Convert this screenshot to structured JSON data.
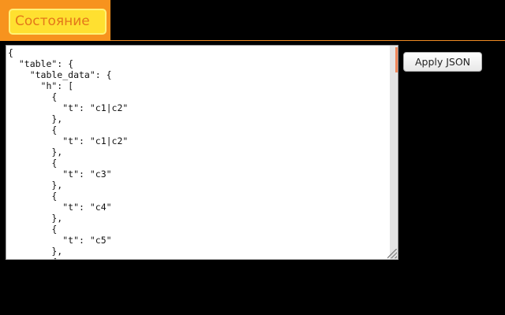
{
  "header": {
    "state_button_label": "Состояние"
  },
  "editor": {
    "content": "{\n  \"table\": {\n    \"table_data\": {\n      \"h\": [\n        {\n          \"t\": \"c1|c2\"\n        },\n        {\n          \"t\": \"c1|c2\"\n        },\n        {\n          \"t\": \"c3\"\n        },\n        {\n          \"t\": \"c4\"\n        },\n        {\n          \"t\": \"c5\"\n        },\n        {"
  },
  "actions": {
    "apply_label": "Apply JSON"
  },
  "colors": {
    "background": "#000000",
    "tab_orange": "#f7931e",
    "button_yellow": "#ffe030",
    "button_text": "#e4771a",
    "divider": "#f08a24",
    "scroll_thumb": "#f0885a"
  }
}
